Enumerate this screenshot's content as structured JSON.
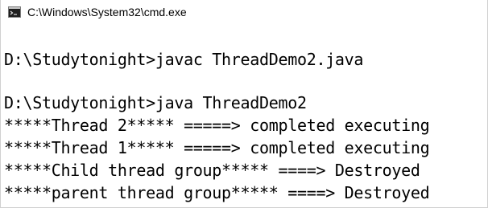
{
  "window": {
    "title": "C:\\Windows\\System32\\cmd.exe",
    "icon": "cmd-icon"
  },
  "console": {
    "lines": [
      "",
      "D:\\Studytonight>javac ThreadDemo2.java",
      "",
      "D:\\Studytonight>java ThreadDemo2",
      "*****Thread 2***** =====> completed executing",
      "*****Thread 1***** =====> completed executing",
      "*****Child thread group***** ====> Destroyed",
      "*****parent thread group***** ====> Destroyed"
    ]
  }
}
